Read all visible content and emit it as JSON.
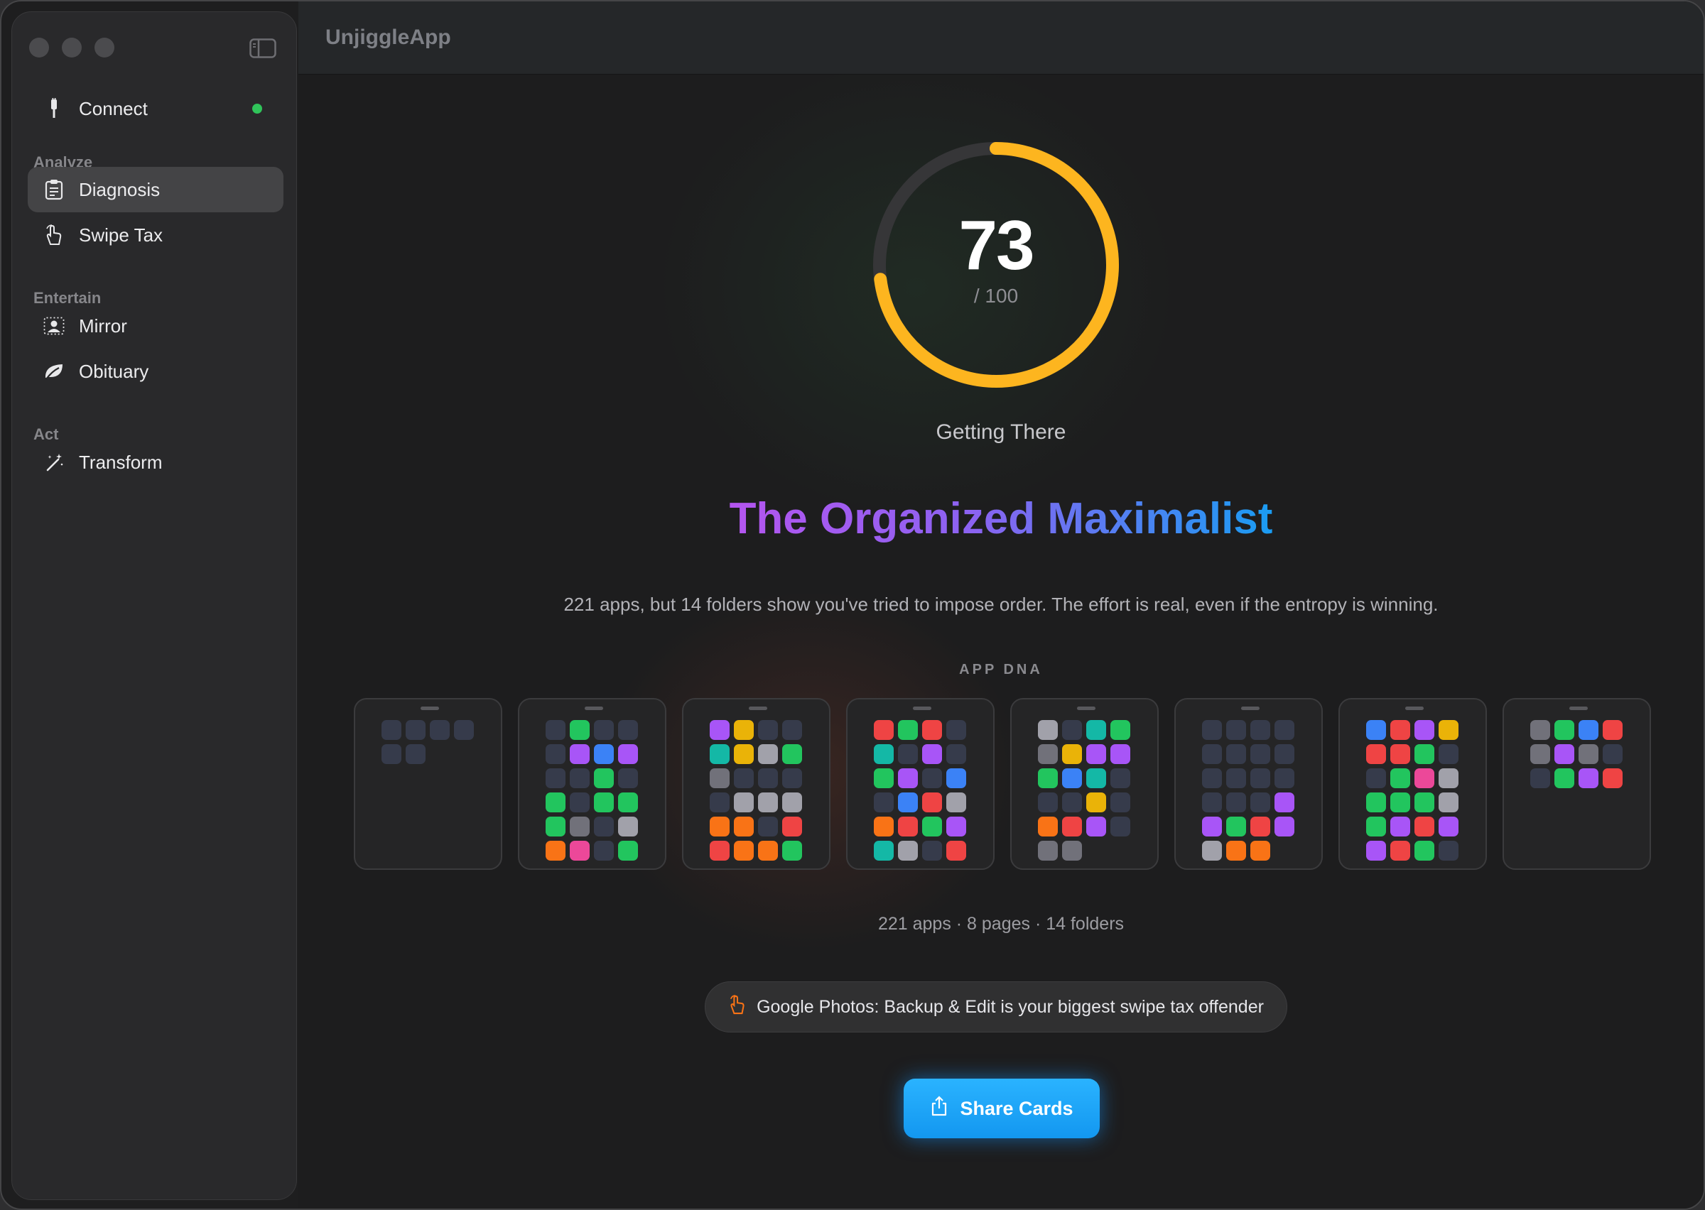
{
  "app": {
    "title": "UnjiggleApp"
  },
  "sidebar": {
    "connect": {
      "label": "Connect",
      "icon": "cable-icon",
      "status_color": "#30c45a"
    },
    "sections": [
      {
        "label": "Analyze",
        "items": [
          {
            "label": "Diagnosis",
            "icon": "clipboard-icon",
            "active": true
          },
          {
            "label": "Swipe Tax",
            "icon": "hand-swipe-icon"
          }
        ]
      },
      {
        "label": "Entertain",
        "items": [
          {
            "label": "Mirror",
            "icon": "person-portrait-icon"
          },
          {
            "label": "Obituary",
            "icon": "leaf-icon"
          }
        ]
      },
      {
        "label": "Act",
        "items": [
          {
            "label": "Transform",
            "icon": "magic-wand-icon"
          }
        ]
      }
    ]
  },
  "score": {
    "value": "73",
    "max_label": "/ 100",
    "fraction": 0.73,
    "grade": "Getting There",
    "arc_color": "#fdb51f"
  },
  "persona": {
    "title": "The Organized Maximalist",
    "description": "221 apps, but 14 folders show you've tried to impose order. The effort is real, even if the entropy is winning."
  },
  "dna": {
    "label": "APP DNA",
    "colors": {
      "D": "#363b4b",
      "G": "#22c55e",
      "B": "#3b82f6",
      "P": "#a855f7",
      "Y": "#eab308",
      "T": "#14b8a6",
      "S": "#a1a1aa",
      "O": "#f97316",
      "R": "#ef4444",
      "K": "#ec4899",
      "N": "#71717a"
    },
    "pages": [
      "DDDDDD",
      "DGDDDPBPDDGDGDGGGNDSOKDG",
      "PYDDTYSGNDDDDSSSOODRROOG",
      "RGRDTDPDGPDBDBRSORGPTSDR",
      "SDTGNYPPGBTDDDYDORPDNN",
      "DDDDDDDDDDDDDDDPPGRPSOO",
      "BRPYRRGDDGKSGGGSGPRPPRGD",
      "NGBRNPNDDGPR"
    ]
  },
  "stats": "221 apps · 8 pages · 14 folders",
  "offender": {
    "icon": "hand-swipe-icon",
    "text": "Google Photos: Backup & Edit is your biggest swipe tax offender"
  },
  "share": {
    "label": "Share Cards",
    "icon": "share-icon"
  }
}
